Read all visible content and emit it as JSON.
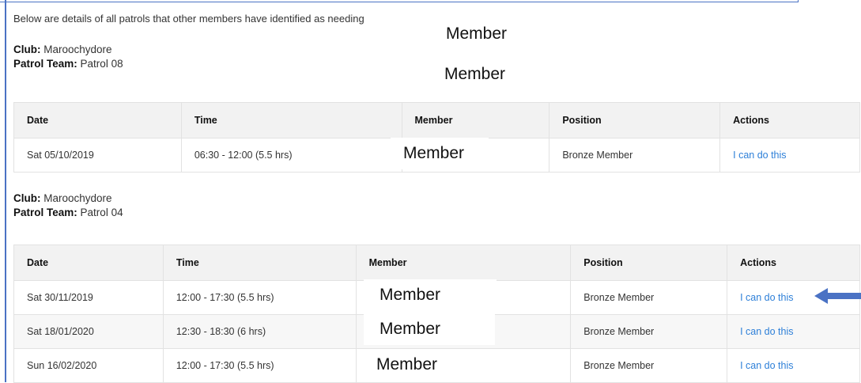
{
  "intro_text": "Below are details of all patrols that other members have identified as needing",
  "overlay_label": "Member",
  "club_label": "Club:",
  "team_label": "Patrol Team:",
  "columns": [
    "Date",
    "Time",
    "Member",
    "Position",
    "Actions"
  ],
  "groups": [
    {
      "club": "Maroochydore",
      "team": "Patrol 08",
      "rows": [
        {
          "date": "Sat 05/10/2019",
          "time": "06:30 - 12:00 (5.5 hrs)",
          "member": "Member",
          "position": "Bronze Member",
          "action": "I can do this"
        }
      ]
    },
    {
      "club": "Maroochydore",
      "team": "Patrol 04",
      "rows": [
        {
          "date": "Sat 30/11/2019",
          "time": "12:00 - 17:30 (5.5 hrs)",
          "member": "Member",
          "position": "Bronze Member",
          "action": "I can do this"
        },
        {
          "date": "Sat 18/01/2020",
          "time": "12:30 - 18:30 (6 hrs)",
          "member": "Member",
          "position": "Bronze Member",
          "action": "I can do this"
        },
        {
          "date": "Sun 16/02/2020",
          "time": "12:00 - 17:30 (5.5 hrs)",
          "member": "Member",
          "position": "Bronze Member",
          "action": "I can do this"
        }
      ]
    }
  ],
  "colors": {
    "link": "#2d7fd8",
    "frame": "#4a72c4",
    "arrow": "#4a72c4",
    "header_bg": "#f2f2f2"
  },
  "icons": {
    "pointer_arrow": "left-arrow-icon"
  }
}
